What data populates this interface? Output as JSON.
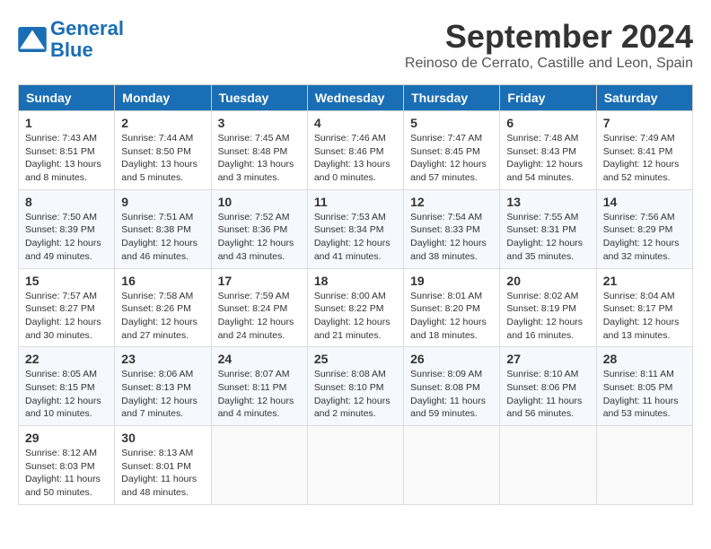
{
  "logo": {
    "line1": "General",
    "line2": "Blue"
  },
  "title": "September 2024",
  "location": "Reinoso de Cerrato, Castille and Leon, Spain",
  "headers": [
    "Sunday",
    "Monday",
    "Tuesday",
    "Wednesday",
    "Thursday",
    "Friday",
    "Saturday"
  ],
  "weeks": [
    [
      {
        "day": "1",
        "sunrise": "Sunrise: 7:43 AM",
        "sunset": "Sunset: 8:51 PM",
        "daylight": "Daylight: 13 hours and 8 minutes."
      },
      {
        "day": "2",
        "sunrise": "Sunrise: 7:44 AM",
        "sunset": "Sunset: 8:50 PM",
        "daylight": "Daylight: 13 hours and 5 minutes."
      },
      {
        "day": "3",
        "sunrise": "Sunrise: 7:45 AM",
        "sunset": "Sunset: 8:48 PM",
        "daylight": "Daylight: 13 hours and 3 minutes."
      },
      {
        "day": "4",
        "sunrise": "Sunrise: 7:46 AM",
        "sunset": "Sunset: 8:46 PM",
        "daylight": "Daylight: 13 hours and 0 minutes."
      },
      {
        "day": "5",
        "sunrise": "Sunrise: 7:47 AM",
        "sunset": "Sunset: 8:45 PM",
        "daylight": "Daylight: 12 hours and 57 minutes."
      },
      {
        "day": "6",
        "sunrise": "Sunrise: 7:48 AM",
        "sunset": "Sunset: 8:43 PM",
        "daylight": "Daylight: 12 hours and 54 minutes."
      },
      {
        "day": "7",
        "sunrise": "Sunrise: 7:49 AM",
        "sunset": "Sunset: 8:41 PM",
        "daylight": "Daylight: 12 hours and 52 minutes."
      }
    ],
    [
      {
        "day": "8",
        "sunrise": "Sunrise: 7:50 AM",
        "sunset": "Sunset: 8:39 PM",
        "daylight": "Daylight: 12 hours and 49 minutes."
      },
      {
        "day": "9",
        "sunrise": "Sunrise: 7:51 AM",
        "sunset": "Sunset: 8:38 PM",
        "daylight": "Daylight: 12 hours and 46 minutes."
      },
      {
        "day": "10",
        "sunrise": "Sunrise: 7:52 AM",
        "sunset": "Sunset: 8:36 PM",
        "daylight": "Daylight: 12 hours and 43 minutes."
      },
      {
        "day": "11",
        "sunrise": "Sunrise: 7:53 AM",
        "sunset": "Sunset: 8:34 PM",
        "daylight": "Daylight: 12 hours and 41 minutes."
      },
      {
        "day": "12",
        "sunrise": "Sunrise: 7:54 AM",
        "sunset": "Sunset: 8:33 PM",
        "daylight": "Daylight: 12 hours and 38 minutes."
      },
      {
        "day": "13",
        "sunrise": "Sunrise: 7:55 AM",
        "sunset": "Sunset: 8:31 PM",
        "daylight": "Daylight: 12 hours and 35 minutes."
      },
      {
        "day": "14",
        "sunrise": "Sunrise: 7:56 AM",
        "sunset": "Sunset: 8:29 PM",
        "daylight": "Daylight: 12 hours and 32 minutes."
      }
    ],
    [
      {
        "day": "15",
        "sunrise": "Sunrise: 7:57 AM",
        "sunset": "Sunset: 8:27 PM",
        "daylight": "Daylight: 12 hours and 30 minutes."
      },
      {
        "day": "16",
        "sunrise": "Sunrise: 7:58 AM",
        "sunset": "Sunset: 8:26 PM",
        "daylight": "Daylight: 12 hours and 27 minutes."
      },
      {
        "day": "17",
        "sunrise": "Sunrise: 7:59 AM",
        "sunset": "Sunset: 8:24 PM",
        "daylight": "Daylight: 12 hours and 24 minutes."
      },
      {
        "day": "18",
        "sunrise": "Sunrise: 8:00 AM",
        "sunset": "Sunset: 8:22 PM",
        "daylight": "Daylight: 12 hours and 21 minutes."
      },
      {
        "day": "19",
        "sunrise": "Sunrise: 8:01 AM",
        "sunset": "Sunset: 8:20 PM",
        "daylight": "Daylight: 12 hours and 18 minutes."
      },
      {
        "day": "20",
        "sunrise": "Sunrise: 8:02 AM",
        "sunset": "Sunset: 8:19 PM",
        "daylight": "Daylight: 12 hours and 16 minutes."
      },
      {
        "day": "21",
        "sunrise": "Sunrise: 8:04 AM",
        "sunset": "Sunset: 8:17 PM",
        "daylight": "Daylight: 12 hours and 13 minutes."
      }
    ],
    [
      {
        "day": "22",
        "sunrise": "Sunrise: 8:05 AM",
        "sunset": "Sunset: 8:15 PM",
        "daylight": "Daylight: 12 hours and 10 minutes."
      },
      {
        "day": "23",
        "sunrise": "Sunrise: 8:06 AM",
        "sunset": "Sunset: 8:13 PM",
        "daylight": "Daylight: 12 hours and 7 minutes."
      },
      {
        "day": "24",
        "sunrise": "Sunrise: 8:07 AM",
        "sunset": "Sunset: 8:11 PM",
        "daylight": "Daylight: 12 hours and 4 minutes."
      },
      {
        "day": "25",
        "sunrise": "Sunrise: 8:08 AM",
        "sunset": "Sunset: 8:10 PM",
        "daylight": "Daylight: 12 hours and 2 minutes."
      },
      {
        "day": "26",
        "sunrise": "Sunrise: 8:09 AM",
        "sunset": "Sunset: 8:08 PM",
        "daylight": "Daylight: 11 hours and 59 minutes."
      },
      {
        "day": "27",
        "sunrise": "Sunrise: 8:10 AM",
        "sunset": "Sunset: 8:06 PM",
        "daylight": "Daylight: 11 hours and 56 minutes."
      },
      {
        "day": "28",
        "sunrise": "Sunrise: 8:11 AM",
        "sunset": "Sunset: 8:05 PM",
        "daylight": "Daylight: 11 hours and 53 minutes."
      }
    ],
    [
      {
        "day": "29",
        "sunrise": "Sunrise: 8:12 AM",
        "sunset": "Sunset: 8:03 PM",
        "daylight": "Daylight: 11 hours and 50 minutes."
      },
      {
        "day": "30",
        "sunrise": "Sunrise: 8:13 AM",
        "sunset": "Sunset: 8:01 PM",
        "daylight": "Daylight: 11 hours and 48 minutes."
      },
      null,
      null,
      null,
      null,
      null
    ]
  ]
}
